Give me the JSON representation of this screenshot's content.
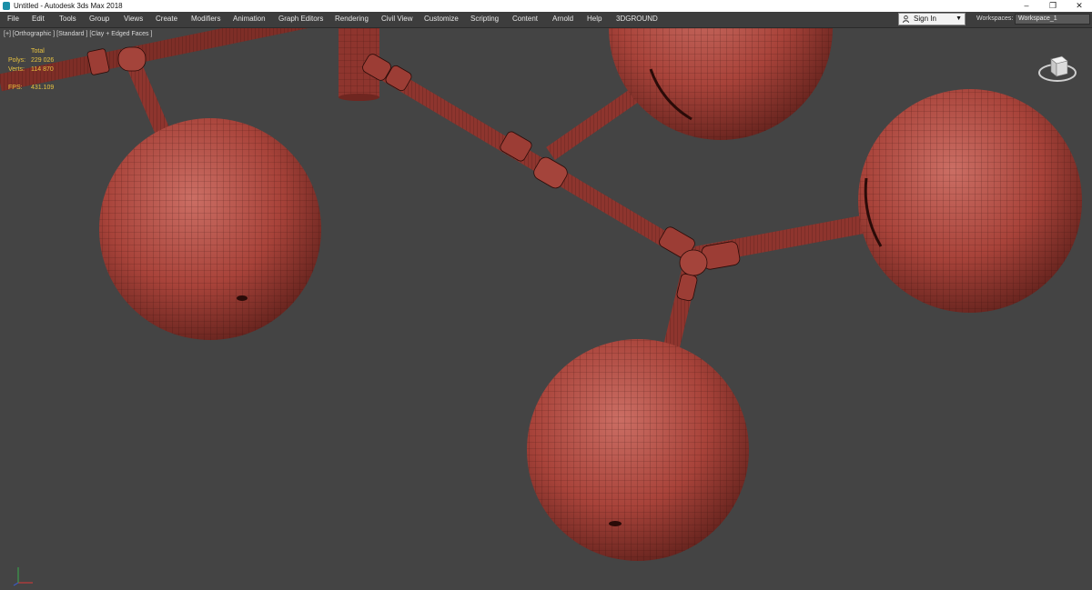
{
  "window": {
    "title": "Untitled - Autodesk 3ds Max 2018",
    "controls": [
      "–",
      "❐",
      "✕"
    ]
  },
  "menubar": {
    "items": [
      "File",
      "Edit",
      "Tools",
      "Group",
      "Views",
      "Create",
      "Modifiers",
      "Animation",
      "Graph Editors",
      "Rendering",
      "Civil View",
      "Customize",
      "Scripting",
      "Content",
      "Arnold",
      "Help",
      "3DGROUND"
    ],
    "sign_in": "Sign In",
    "workspaces_label": "Workspaces:",
    "workspace_value": "Workspace_1"
  },
  "viewport": {
    "label": "[+] [Orthographic ] [Standard ] [Clay + Edged Faces ]",
    "stats": {
      "total_label": "Total",
      "polys_label": "Polys:",
      "polys_value": "229 026",
      "verts_label": "Verts:",
      "verts_value": "114 870",
      "fps_label": "FPS:",
      "fps_value": "431.109"
    },
    "model_color": "#a8433a",
    "background_color": "#444444"
  }
}
